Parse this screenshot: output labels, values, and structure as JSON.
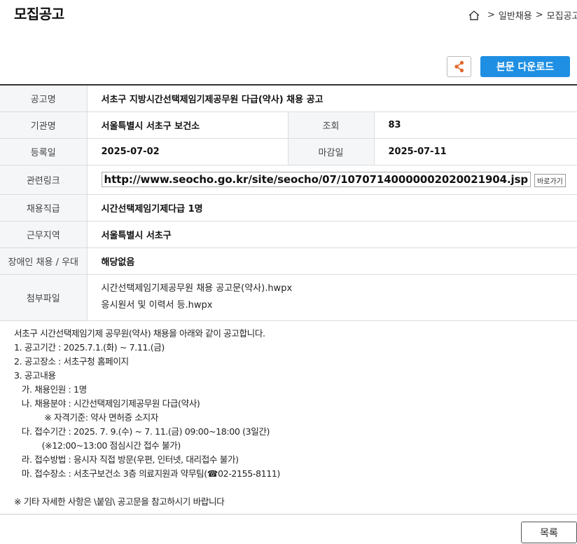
{
  "page": {
    "title": "모집공고"
  },
  "breadcrumb": {
    "home_icon": "home-icon",
    "separator": ">",
    "items": [
      "일반채용",
      "모집공고"
    ]
  },
  "toolbar": {
    "share_icon": "share-icon",
    "download_label": "본문 다운로드",
    "accent": "#1e8fe3"
  },
  "info": {
    "title_label": "공고명",
    "title_value": "서초구 지방시간선택제임기제공무원 다급(약사) 채용 공고",
    "org_label": "기관명",
    "org_value": "서울특별시 서초구 보건소",
    "views_label": "조회",
    "views_value": "83",
    "reg_label": "등록일",
    "reg_value": "2025-07-02",
    "deadline_label": "마감일",
    "deadline_value": "2025-07-11",
    "link_label": "관련링크",
    "link_value": "http://www.seocho.go.kr/site/seocho/07/10707140000002020021904.jsp",
    "link_button": "바로가기",
    "position_label": "채용직급",
    "position_value": "시간선택제임기제다급 1명",
    "region_label": "근무지역",
    "region_value": "서울특별시 서초구",
    "disabled_label": "장애인 채용 / 우대",
    "disabled_value": "해당없음",
    "files_label": "첨부파일",
    "files": [
      "시간선택제임기제공무원 채용 공고문(약사).hwpx",
      "응시원서 및 이력서 등.hwpx"
    ]
  },
  "body_text": "서초구 시간선택제임기제 공무원(약사) 채용을 아래와 같이 공고합니다.\n1. 공고기간 : 2025.7.1.(화) ~ 7.11.(금)\n2. 공고장소 : 서초구청 홈페이지\n3. 공고내용\n   가. 채용인원 : 1명\n   나. 채용분야 : 시간선택제임기제공무원 다급(약사)\n            ※ 자격기준: 약사 면허증 소지자\n   다. 접수기간 : 2025. 7. 9.(수) ~ 7. 11.(금) 09:00~18:00 (3일간)\n           (※12:00~13:00 점심시간 접수 불가)\n   라. 접수방법 : 응시자 직접 방문(우편, 인터넷, 대리접수 불가)\n   마. 접수장소 : 서초구보건소 3층 의료지원과 약무팀(☎02-2155-8111)\n\n※ 기타 자세한 사항은 \\붙임\\ 공고문을 참고하시기 바랍니다",
  "footer": {
    "list_label": "목록"
  }
}
